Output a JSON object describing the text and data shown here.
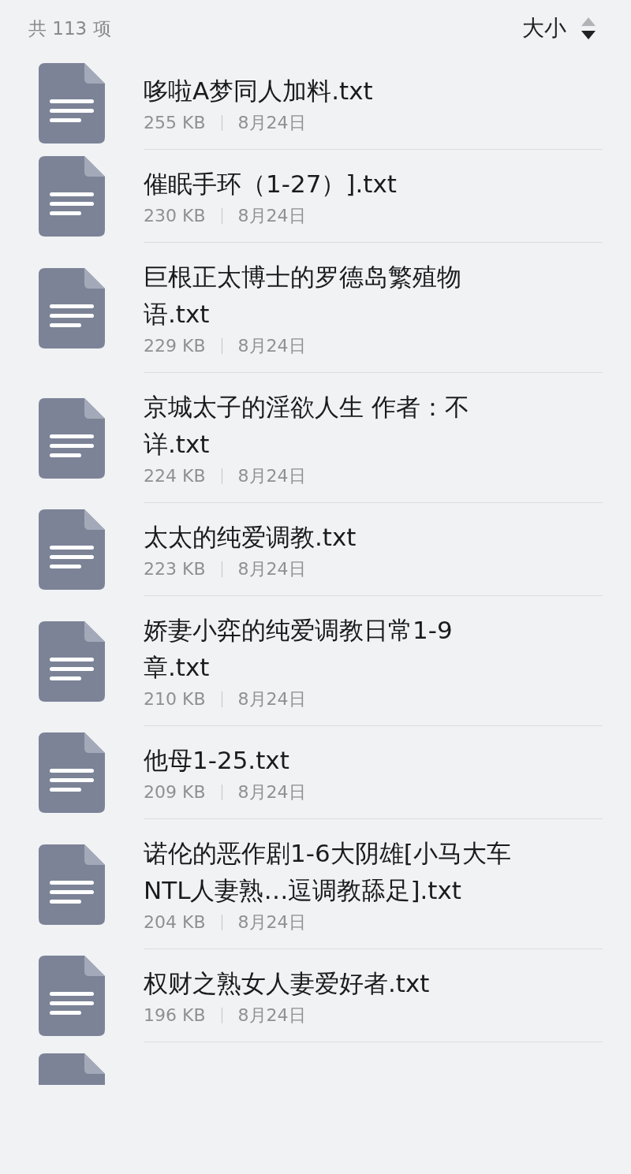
{
  "header": {
    "count": "共 113 项",
    "sort": {
      "label": "大小",
      "descending": true
    }
  },
  "files": [
    {
      "name": "哆啦A梦同人加料.txt",
      "size": "255 KB",
      "date": "8月24日"
    },
    {
      "name": "催眠手环（1-27）].txt",
      "size": "230 KB",
      "date": "8月24日"
    },
    {
      "name": "巨根正太博士的罗德岛繁殖物语.txt",
      "size": "229 KB",
      "date": "8月24日"
    },
    {
      "name": "京城太子的淫欲人生 作者：不详.txt",
      "size": "224 KB",
      "date": "8月24日"
    },
    {
      "name": "太太的纯爱调教.txt",
      "size": "223 KB",
      "date": "8月24日"
    },
    {
      "name": "娇妻小弈的纯爱调教日常1-9章.txt",
      "size": "210 KB",
      "date": "8月24日"
    },
    {
      "name": "他母1-25.txt",
      "size": "209 KB",
      "date": "8月24日"
    },
    {
      "name": "诺伦的恶作剧1-6大阴雄[小马大车NTL人妻熟…逗调教舔足].txt",
      "size": "204 KB",
      "date": "8月24日"
    },
    {
      "name": "权财之熟女人妻爱好者.txt",
      "size": "196 KB",
      "date": "8月24日"
    }
  ]
}
